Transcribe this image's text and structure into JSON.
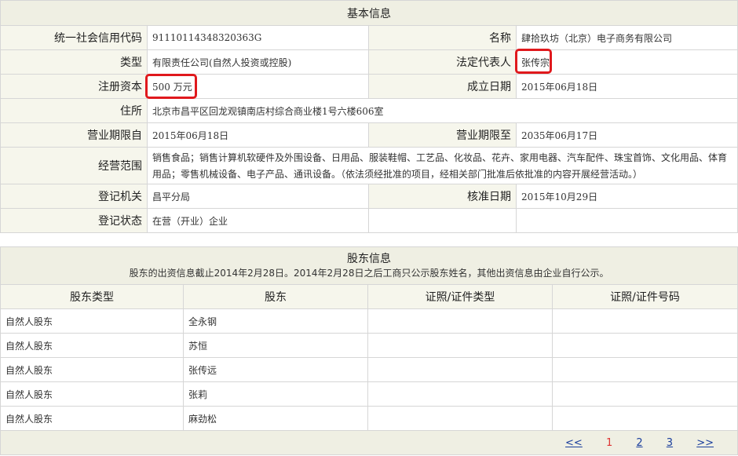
{
  "basic": {
    "title": "基本信息",
    "credit_code_label": "统一社会信用代码",
    "credit_code": "91110114348320363G",
    "name_label": "名称",
    "name": "肆拾玖坊（北京）电子商务有限公司",
    "type_label": "类型",
    "type": "有限责任公司(自然人投资或控股)",
    "legal_rep_label": "法定代表人",
    "legal_rep": "张传宗",
    "capital_label": "注册资本",
    "capital": "500 万元",
    "est_date_label": "成立日期",
    "est_date": "2015年06月18日",
    "address_label": "住所",
    "address": "北京市昌平区回龙观镇南店村综合商业楼1号六楼606室",
    "term_from_label": "营业期限自",
    "term_from": "2015年06月18日",
    "term_to_label": "营业期限至",
    "term_to": "2035年06月17日",
    "scope_label": "经营范围",
    "scope": "销售食品；销售计算机软硬件及外围设备、日用品、服装鞋帽、工艺品、化妆品、花卉、家用电器、汽车配件、珠宝首饰、文化用品、体育用品；零售机械设备、电子产品、通讯设备。（依法须经批准的项目，经相关部门批准后依批准的内容开展经营活动。）",
    "authority_label": "登记机关",
    "authority": "昌平分局",
    "approve_date_label": "核准日期",
    "approve_date": "2015年10月29日",
    "status_label": "登记状态",
    "status": "在营（开业）企业"
  },
  "shareholders": {
    "title": "股东信息",
    "note": "股东的出资信息截止2014年2月28日。2014年2月28日之后工商只公示股东姓名，其他出资信息由企业自行公示。",
    "columns": [
      "股东类型",
      "股东",
      "证照/证件类型",
      "证照/证件号码"
    ],
    "rows": [
      [
        "自然人股东",
        "全永钢",
        "",
        ""
      ],
      [
        "自然人股东",
        "苏恒",
        "",
        ""
      ],
      [
        "自然人股东",
        "张传远",
        "",
        ""
      ],
      [
        "自然人股东",
        "张莉",
        "",
        ""
      ],
      [
        "自然人股东",
        "麻劲松",
        "",
        ""
      ]
    ],
    "pager": {
      "prev": "<<",
      "pages": [
        "1",
        "2",
        "3"
      ],
      "current": "1",
      "next": ">>"
    }
  },
  "highlight_color": "#e0191d"
}
